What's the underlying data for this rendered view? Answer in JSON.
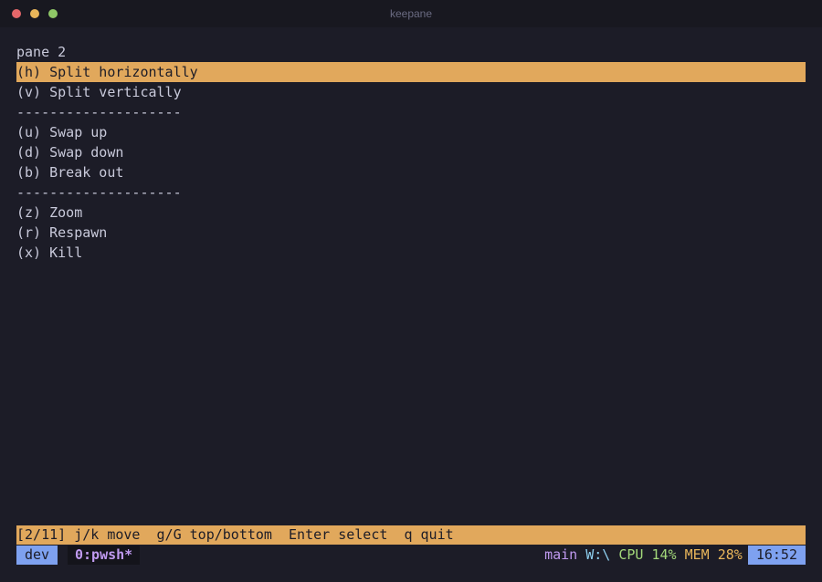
{
  "window": {
    "title": "keepane"
  },
  "menu": {
    "header": "pane 2",
    "items": [
      {
        "label": "(h) Split horizontally",
        "selected": true
      },
      {
        "label": "(v) Split vertically",
        "selected": false
      },
      {
        "label": "--------------------",
        "separator": true
      },
      {
        "label": "(u) Swap up",
        "selected": false
      },
      {
        "label": "(d) Swap down",
        "selected": false
      },
      {
        "label": "(b) Break out",
        "selected": false
      },
      {
        "label": "--------------------",
        "separator": true
      },
      {
        "label": "(z) Zoom",
        "selected": false
      },
      {
        "label": "(r) Respawn",
        "selected": false
      },
      {
        "label": "(x) Kill",
        "selected": false
      }
    ]
  },
  "helpbar": {
    "text": "[2/11] j/k move  g/G top/bottom  Enter select  q quit"
  },
  "statusbar": {
    "session": "dev",
    "window_tab": "0:pwsh*",
    "branch": "main",
    "path": "W:\\",
    "cpu": "CPU 14%",
    "mem": "MEM 28%",
    "clock": "16:52"
  },
  "colors": {
    "background": "#1c1c27",
    "highlight": "#e1a85c",
    "accent_blue": "#7ea1f0",
    "accent_purple": "#c09af0",
    "accent_cyan": "#8fd0f0",
    "accent_green": "#a3d87a",
    "accent_yellow": "#e9b65a"
  }
}
